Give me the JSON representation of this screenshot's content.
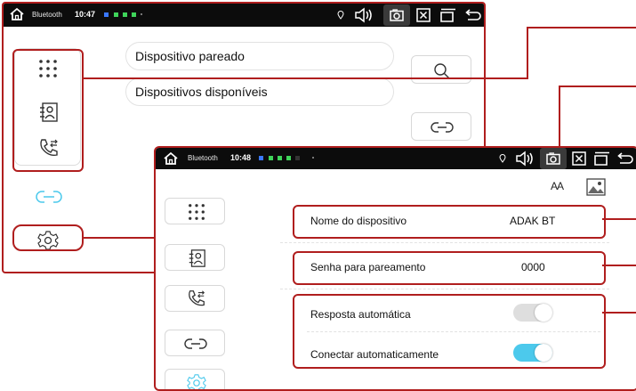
{
  "screen_back": {
    "status": {
      "app_name": "Bluetooth",
      "time": "10:47",
      "indicator_colors": [
        "#3a78ff",
        "#3fd45a",
        "#3fd45a",
        "#3fd45a",
        "#555555"
      ]
    },
    "list": {
      "paired_label": "Dispositivo pareado",
      "available_label": "Dispositivos disponíveis"
    },
    "side_actions": [
      "search-icon",
      "link-icon"
    ],
    "nav": [
      "dialpad-icon",
      "contacts-icon",
      "call-log-icon",
      "link-icon",
      "settings-icon"
    ]
  },
  "screen_front": {
    "status": {
      "app_name": "Bluetooth",
      "time": "10:48",
      "indicator_colors": [
        "#3a78ff",
        "#3fd45a",
        "#3fd45a",
        "#3fd45a",
        "#555555"
      ]
    },
    "top_icons": {
      "font_size_label": "AA",
      "wallpaper": "image-icon"
    },
    "settings": {
      "device_name": {
        "label": "Nome do dispositivo",
        "value": "ADAK BT"
      },
      "pairing_password": {
        "label": "Senha para pareamento",
        "value": "0000"
      },
      "auto_answer": {
        "label": "Resposta automática",
        "enabled": false
      },
      "auto_connect": {
        "label": "Conectar automaticamente",
        "enabled": true
      }
    },
    "nav": [
      "dialpad-icon",
      "contacts-icon",
      "call-log-icon",
      "link-icon",
      "settings-icon"
    ]
  },
  "colors": {
    "highlight_red": "#b01e1e",
    "accent_cyan": "#4cc9ec",
    "toggle_off": "#dedede",
    "status_bar": "#0c0c0c"
  }
}
